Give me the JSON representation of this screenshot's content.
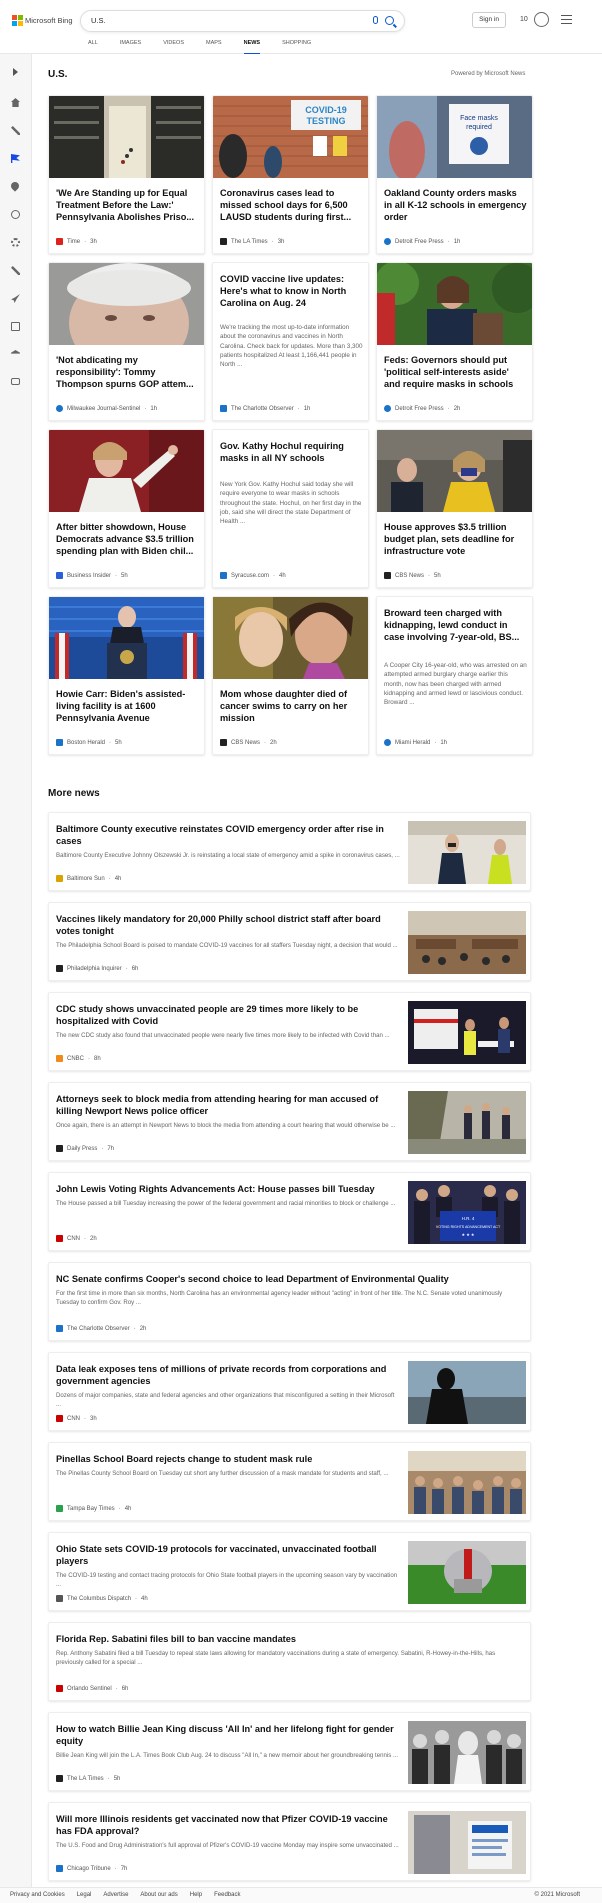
{
  "header": {
    "logo_text": "Microsoft Bing",
    "search_value": "U.S.",
    "signin_label": "Sign in",
    "points": "10",
    "tabs": [
      "ALL",
      "IMAGES",
      "VIDEOS",
      "MAPS",
      "NEWS",
      "SHOPPING"
    ],
    "active_tab": "NEWS"
  },
  "section": {
    "title": "U.S.",
    "powered_by": "Powered by Microsoft News"
  },
  "cards": [
    {
      "title": "'We Are Standing up for Equal Treatment Before the Law:' Pennsylvania Abolishes Priso...",
      "source": "Time",
      "time": "3h",
      "logo_color": "#e0201b"
    },
    {
      "title": "Coronavirus cases lead to missed school days for 6,500 LAUSD students during first...",
      "source": "The LA Times",
      "time": "3h",
      "logo_color": "#222222"
    },
    {
      "title": "Oakland County orders masks in all K-12 schools in emergency order",
      "source": "Detroit Free Press",
      "time": "1h",
      "logo_color": "#1a73c8"
    },
    {
      "title": "'Not abdicating my responsibility': Tommy Thompson spurns GOP attem...",
      "source": "Milwaukee Journal-Sentinel",
      "time": "1h",
      "logo_color": "#1a73c8"
    },
    {
      "title": "COVID vaccine live updates: Here's what to know in North Carolina on Aug. 24",
      "snippet": "We're tracking the most up-to-date information about the coronavirus and vaccines in North Carolina. Check back for updates. More than 3,300 patients hospitalized At least 1,166,441 people in North ...",
      "source": "The Charlotte Observer",
      "time": "1h",
      "logo_color": "#1a73c8"
    },
    {
      "title": "Feds: Governors should put 'political self-interests aside' and require masks in schools",
      "source": "Detroit Free Press",
      "time": "2h",
      "logo_color": "#1a73c8"
    },
    {
      "title": "After bitter showdown, House Democrats advance $3.5 trillion spending plan with Biden chil...",
      "source": "Business Insider",
      "time": "5h",
      "logo_color": "#2a5fd8"
    },
    {
      "title": "Gov. Kathy Hochul requiring masks in all NY schools",
      "snippet": "New York Gov. Kathy Hochul said today she will require everyone to wear masks in schools throughout the state. Hochul, on her first day in the job, said she will direct the state Department of Health ...",
      "source": "Syracuse.com",
      "time": "4h",
      "logo_color": "#1a73c8"
    },
    {
      "title": "House approves $3.5 trillion budget plan, sets deadline for infrastructure vote",
      "source": "CBS News",
      "time": "5h",
      "logo_color": "#222222"
    },
    {
      "title": "Howie Carr: Biden's assisted-living facility is at 1600 Pennsylvania Avenue",
      "source": "Boston Herald",
      "time": "5h",
      "logo_color": "#1a73c8"
    },
    {
      "title": "Mom whose daughter died of cancer swims to carry on her mission",
      "source": "CBS News",
      "time": "2h",
      "logo_color": "#222222"
    },
    {
      "title": "Broward teen charged with kidnapping, lewd conduct in case involving 7-year-old, BS...",
      "snippet": "A Cooper City 16-year-old, who was arrested on an attempted armed burglary charge earlier this month, now has been charged with armed kidnapping and armed lewd or lascivious conduct. Broward ...",
      "source": "Miami Herald",
      "time": "1h",
      "logo_color": "#1a73c8"
    }
  ],
  "more_news": {
    "title": "More news",
    "items": [
      {
        "title": "Baltimore County executive reinstates COVID emergency order after rise in cases",
        "snippet": "Baltimore County Executive Johnny Olszewski Jr. is reinstating a local state of emergency amid a spike in coronavirus cases, ...",
        "source": "Baltimore Sun",
        "time": "4h",
        "logo_color": "#d9a400"
      },
      {
        "title": "Vaccines likely mandatory for 20,000 Philly school district staff after board votes tonight",
        "snippet": "The Philadelphia School Board is poised to mandate COVID-19 vaccines for all staffers Tuesday night, a decision that would ...",
        "source": "Philadelphia Inquirer",
        "time": "6h",
        "logo_color": "#222222"
      },
      {
        "title": "CDC study shows unvaccinated people are 29 times more likely to be hospitalized with Covid",
        "snippet": "The new CDC study also found that unvaccinated people were nearly five times more likely to be infected with Covid than ...",
        "source": "CNBC",
        "time": "8h",
        "logo_color": "#f28a1a"
      },
      {
        "title": "Attorneys seek to block media from attending hearing for man accused of killing Newport News police officer",
        "snippet": "Once again, there is an attempt in Newport News to block the media from attending a court hearing that would otherwise be ...",
        "source": "Daily Press",
        "time": "7h",
        "logo_color": "#222222"
      },
      {
        "title": "John Lewis Voting Rights Advancements Act: House passes bill Tuesday",
        "snippet": "The House passed a bill Tuesday increasing the power of the federal government and racial minorities to block or challenge ...",
        "source": "CNN",
        "time": "2h",
        "logo_color": "#cc0000",
        "img_text": "H.R. 4 VOTING RIGHTS ADVANCEMENT ACT"
      },
      {
        "title": "NC Senate confirms Cooper's second choice to lead Department of Environmental Quality",
        "snippet": "For the first time in more than six months, North Carolina has an environmental agency leader without \"acting\" in front of her title. The N.C. Senate voted unanimously Tuesday to confirm Gov. Roy ...",
        "source": "The Charlotte Observer",
        "time": "2h",
        "logo_color": "#1a73c8"
      },
      {
        "title": "Data leak exposes tens of millions of private records from corporations and government agencies",
        "snippet": "Dozens of major companies, state and federal agencies and other organizations that misconfigured a setting in their Microsoft ...",
        "source": "CNN",
        "time": "3h",
        "logo_color": "#cc0000"
      },
      {
        "title": "Pinellas School Board rejects change to student mask rule",
        "snippet": "The Pinellas County School Board on Tuesday cut short any further discussion of a mask mandate for students and staff, ...",
        "source": "Tampa Bay Times",
        "time": "4h",
        "logo_color": "#2aa14c"
      },
      {
        "title": "Ohio State sets COVID-19 protocols for vaccinated, unvaccinated football players",
        "snippet": "The COVID-19 testing and contact tracing protocols for Ohio State football players in the upcoming season vary by vaccination ...",
        "source": "The Columbus Dispatch",
        "time": "4h",
        "logo_color": "#555555"
      },
      {
        "title": "Florida Rep. Sabatini files bill to ban vaccine mandates",
        "snippet": "Rep. Anthony Sabatini filed a bill Tuesday to repeal state laws allowing for mandatory vaccinations during a state of emergency. Sabatini, R-Howey-in-the-Hills, has previously called for a special ...",
        "source": "Orlando Sentinel",
        "time": "6h",
        "logo_color": "#cc0000"
      },
      {
        "title": "How to watch Billie Jean King discuss 'All In' and her lifelong fight for gender equity",
        "snippet": "Billie Jean King will join the L.A. Times Book Club Aug. 24 to discuss \"All In,\" a new memoir about her groundbreaking tennis ...",
        "source": "The LA Times",
        "time": "5h",
        "logo_color": "#222222"
      },
      {
        "title": "Will more Illinois residents get vaccinated now that Pfizer COVID-19 vaccine has FDA approval?",
        "snippet": "The U.S. Food and Drug Administration's full approval of Pfizer's COVID-19 vaccine Monday may inspire some unvaccinated ...",
        "source": "Chicago Tribune",
        "time": "7h",
        "logo_color": "#1a73c8"
      }
    ]
  },
  "card_images": {
    "covid_sign": "COVID-19 TESTING",
    "mask_sign": "Face masks required"
  },
  "footer": {
    "links": [
      "Privacy and Cookies",
      "Legal",
      "Advertise",
      "About our ads",
      "Help",
      "Feedback"
    ],
    "copyright": "© 2021 Microsoft"
  }
}
